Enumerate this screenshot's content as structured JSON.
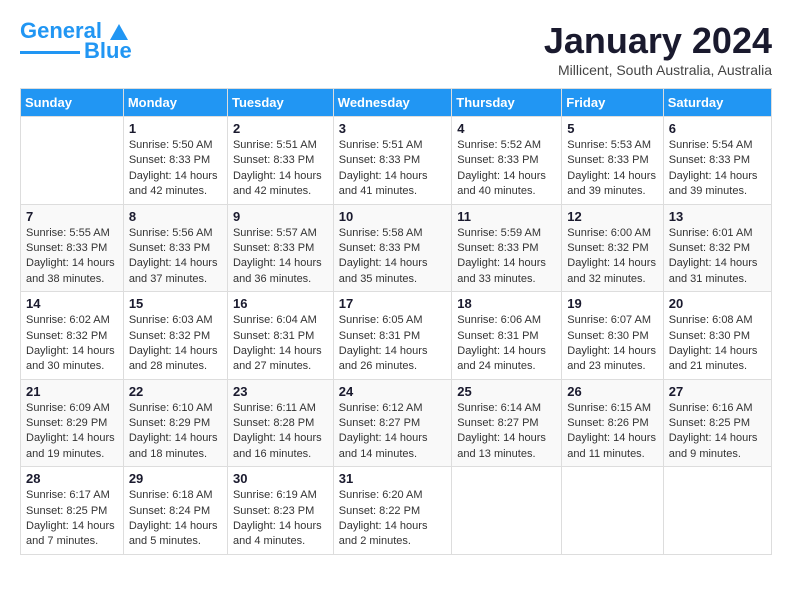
{
  "header": {
    "logo_line1": "General",
    "logo_line2": "Blue",
    "title": "January 2024",
    "subtitle": "Millicent, South Australia, Australia"
  },
  "calendar": {
    "days_of_week": [
      "Sunday",
      "Monday",
      "Tuesday",
      "Wednesday",
      "Thursday",
      "Friday",
      "Saturday"
    ],
    "weeks": [
      [
        {
          "day": "",
          "sunrise": "",
          "sunset": "",
          "daylight": ""
        },
        {
          "day": "1",
          "sunrise": "Sunrise: 5:50 AM",
          "sunset": "Sunset: 8:33 PM",
          "daylight": "Daylight: 14 hours and 42 minutes."
        },
        {
          "day": "2",
          "sunrise": "Sunrise: 5:51 AM",
          "sunset": "Sunset: 8:33 PM",
          "daylight": "Daylight: 14 hours and 42 minutes."
        },
        {
          "day": "3",
          "sunrise": "Sunrise: 5:51 AM",
          "sunset": "Sunset: 8:33 PM",
          "daylight": "Daylight: 14 hours and 41 minutes."
        },
        {
          "day": "4",
          "sunrise": "Sunrise: 5:52 AM",
          "sunset": "Sunset: 8:33 PM",
          "daylight": "Daylight: 14 hours and 40 minutes."
        },
        {
          "day": "5",
          "sunrise": "Sunrise: 5:53 AM",
          "sunset": "Sunset: 8:33 PM",
          "daylight": "Daylight: 14 hours and 39 minutes."
        },
        {
          "day": "6",
          "sunrise": "Sunrise: 5:54 AM",
          "sunset": "Sunset: 8:33 PM",
          "daylight": "Daylight: 14 hours and 39 minutes."
        }
      ],
      [
        {
          "day": "7",
          "sunrise": "Sunrise: 5:55 AM",
          "sunset": "Sunset: 8:33 PM",
          "daylight": "Daylight: 14 hours and 38 minutes."
        },
        {
          "day": "8",
          "sunrise": "Sunrise: 5:56 AM",
          "sunset": "Sunset: 8:33 PM",
          "daylight": "Daylight: 14 hours and 37 minutes."
        },
        {
          "day": "9",
          "sunrise": "Sunrise: 5:57 AM",
          "sunset": "Sunset: 8:33 PM",
          "daylight": "Daylight: 14 hours and 36 minutes."
        },
        {
          "day": "10",
          "sunrise": "Sunrise: 5:58 AM",
          "sunset": "Sunset: 8:33 PM",
          "daylight": "Daylight: 14 hours and 35 minutes."
        },
        {
          "day": "11",
          "sunrise": "Sunrise: 5:59 AM",
          "sunset": "Sunset: 8:33 PM",
          "daylight": "Daylight: 14 hours and 33 minutes."
        },
        {
          "day": "12",
          "sunrise": "Sunrise: 6:00 AM",
          "sunset": "Sunset: 8:32 PM",
          "daylight": "Daylight: 14 hours and 32 minutes."
        },
        {
          "day": "13",
          "sunrise": "Sunrise: 6:01 AM",
          "sunset": "Sunset: 8:32 PM",
          "daylight": "Daylight: 14 hours and 31 minutes."
        }
      ],
      [
        {
          "day": "14",
          "sunrise": "Sunrise: 6:02 AM",
          "sunset": "Sunset: 8:32 PM",
          "daylight": "Daylight: 14 hours and 30 minutes."
        },
        {
          "day": "15",
          "sunrise": "Sunrise: 6:03 AM",
          "sunset": "Sunset: 8:32 PM",
          "daylight": "Daylight: 14 hours and 28 minutes."
        },
        {
          "day": "16",
          "sunrise": "Sunrise: 6:04 AM",
          "sunset": "Sunset: 8:31 PM",
          "daylight": "Daylight: 14 hours and 27 minutes."
        },
        {
          "day": "17",
          "sunrise": "Sunrise: 6:05 AM",
          "sunset": "Sunset: 8:31 PM",
          "daylight": "Daylight: 14 hours and 26 minutes."
        },
        {
          "day": "18",
          "sunrise": "Sunrise: 6:06 AM",
          "sunset": "Sunset: 8:31 PM",
          "daylight": "Daylight: 14 hours and 24 minutes."
        },
        {
          "day": "19",
          "sunrise": "Sunrise: 6:07 AM",
          "sunset": "Sunset: 8:30 PM",
          "daylight": "Daylight: 14 hours and 23 minutes."
        },
        {
          "day": "20",
          "sunrise": "Sunrise: 6:08 AM",
          "sunset": "Sunset: 8:30 PM",
          "daylight": "Daylight: 14 hours and 21 minutes."
        }
      ],
      [
        {
          "day": "21",
          "sunrise": "Sunrise: 6:09 AM",
          "sunset": "Sunset: 8:29 PM",
          "daylight": "Daylight: 14 hours and 19 minutes."
        },
        {
          "day": "22",
          "sunrise": "Sunrise: 6:10 AM",
          "sunset": "Sunset: 8:29 PM",
          "daylight": "Daylight: 14 hours and 18 minutes."
        },
        {
          "day": "23",
          "sunrise": "Sunrise: 6:11 AM",
          "sunset": "Sunset: 8:28 PM",
          "daylight": "Daylight: 14 hours and 16 minutes."
        },
        {
          "day": "24",
          "sunrise": "Sunrise: 6:12 AM",
          "sunset": "Sunset: 8:27 PM",
          "daylight": "Daylight: 14 hours and 14 minutes."
        },
        {
          "day": "25",
          "sunrise": "Sunrise: 6:14 AM",
          "sunset": "Sunset: 8:27 PM",
          "daylight": "Daylight: 14 hours and 13 minutes."
        },
        {
          "day": "26",
          "sunrise": "Sunrise: 6:15 AM",
          "sunset": "Sunset: 8:26 PM",
          "daylight": "Daylight: 14 hours and 11 minutes."
        },
        {
          "day": "27",
          "sunrise": "Sunrise: 6:16 AM",
          "sunset": "Sunset: 8:25 PM",
          "daylight": "Daylight: 14 hours and 9 minutes."
        }
      ],
      [
        {
          "day": "28",
          "sunrise": "Sunrise: 6:17 AM",
          "sunset": "Sunset: 8:25 PM",
          "daylight": "Daylight: 14 hours and 7 minutes."
        },
        {
          "day": "29",
          "sunrise": "Sunrise: 6:18 AM",
          "sunset": "Sunset: 8:24 PM",
          "daylight": "Daylight: 14 hours and 5 minutes."
        },
        {
          "day": "30",
          "sunrise": "Sunrise: 6:19 AM",
          "sunset": "Sunset: 8:23 PM",
          "daylight": "Daylight: 14 hours and 4 minutes."
        },
        {
          "day": "31",
          "sunrise": "Sunrise: 6:20 AM",
          "sunset": "Sunset: 8:22 PM",
          "daylight": "Daylight: 14 hours and 2 minutes."
        },
        {
          "day": "",
          "sunrise": "",
          "sunset": "",
          "daylight": ""
        },
        {
          "day": "",
          "sunrise": "",
          "sunset": "",
          "daylight": ""
        },
        {
          "day": "",
          "sunrise": "",
          "sunset": "",
          "daylight": ""
        }
      ]
    ]
  }
}
